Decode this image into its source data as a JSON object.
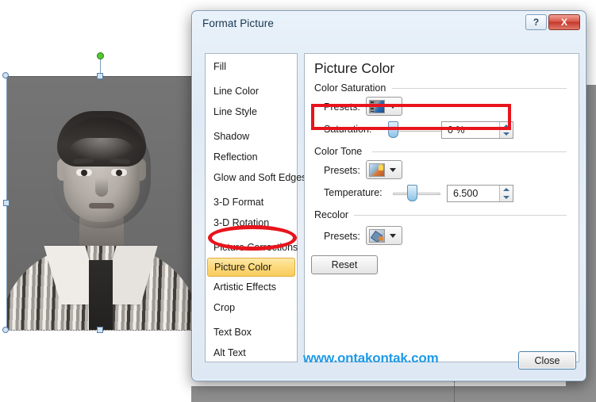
{
  "dialog": {
    "title": "Format Picture",
    "help_label": "?",
    "close_x_label": "X",
    "close_button_label": "Close"
  },
  "sidebar": {
    "items": [
      {
        "label": "Fill",
        "selected": false
      },
      {
        "label": "Line Color",
        "selected": false
      },
      {
        "label": "Line Style",
        "selected": false
      },
      {
        "label": "Shadow",
        "selected": false
      },
      {
        "label": "Reflection",
        "selected": false
      },
      {
        "label": "Glow and Soft Edges",
        "selected": false
      },
      {
        "label": "3-D Format",
        "selected": false
      },
      {
        "label": "3-D Rotation",
        "selected": false
      },
      {
        "label": "Picture Corrections",
        "selected": false
      },
      {
        "label": "Picture Color",
        "selected": true
      },
      {
        "label": "Artistic Effects",
        "selected": false
      },
      {
        "label": "Crop",
        "selected": false
      },
      {
        "label": "Text Box",
        "selected": false
      },
      {
        "label": "Alt Text",
        "selected": false
      }
    ]
  },
  "pane": {
    "title": "Picture Color",
    "groups": {
      "saturation": {
        "label": "Color Saturation",
        "presets_label": "Presets:",
        "presets_icon": "picture-saturation-icon",
        "slider_label": "Saturation:",
        "value": "0 %",
        "slider_percent": 0
      },
      "tone": {
        "label": "Color Tone",
        "presets_label": "Presets:",
        "presets_icon": "picture-temperature-icon",
        "slider_label": "Temperature:",
        "value": "6.500",
        "slider_percent": 50
      },
      "recolor": {
        "label": "Recolor",
        "presets_label": "Presets:",
        "presets_icon": "picture-recolor-icon"
      }
    },
    "reset_label": "Reset"
  },
  "annotations": {
    "watermark": "www.ontakontak.com",
    "highlight_color": "#e8141c",
    "watermark_color": "#1e9ae8",
    "selected_item_color": "#fcd97a"
  },
  "picture": {
    "alt": "Grayscale portrait of a young man in a striped shirt",
    "selected": true
  }
}
